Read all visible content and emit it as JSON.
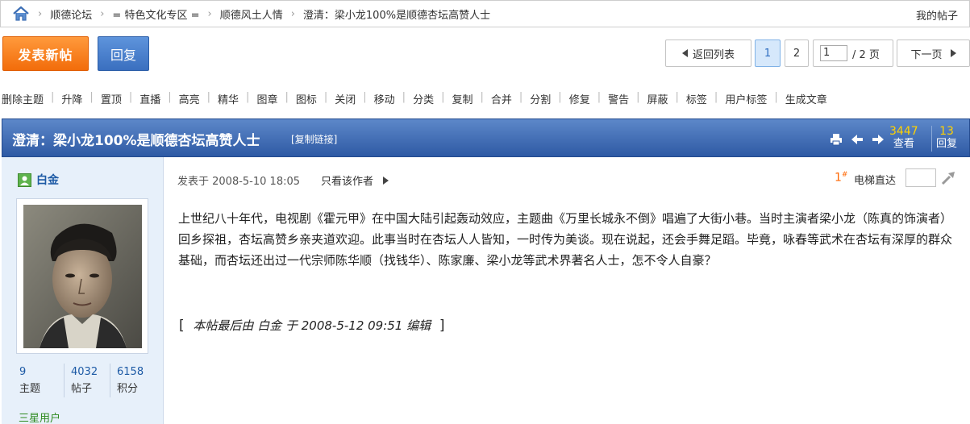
{
  "breadcrumb": {
    "items": [
      "顺德论坛",
      "= 特色文化专区 =",
      "顺德风土人情",
      "澄清：梁小龙100%是顺德杏坛高赞人士"
    ],
    "separator": "›",
    "my_posts": "我的帖子"
  },
  "actions": {
    "new_post": "发表新帖",
    "reply": "回复"
  },
  "pager": {
    "back": "返回列表",
    "pages": [
      "1",
      "2"
    ],
    "current_page": "1",
    "input_value": "1",
    "total": "/ 2 页",
    "next": "下一页"
  },
  "mod_tools": [
    "删除主题",
    "升降",
    "置顶",
    "直播",
    "高亮",
    "精华",
    "图章",
    "图标",
    "关闭",
    "移动",
    "分类",
    "复制",
    "合并",
    "分割",
    "修复",
    "警告",
    "屏蔽",
    "标签",
    "用户标签",
    "生成文章"
  ],
  "thread": {
    "title": "澄清：梁小龙100%是顺德杏坛高赞人士",
    "copy_link": "[复制链接]",
    "views": "3447",
    "views_label": "查看",
    "replies": "13",
    "replies_label": "回复"
  },
  "author": {
    "name": "白金",
    "stats": [
      {
        "value": "9",
        "label": "主题"
      },
      {
        "value": "4032",
        "label": "帖子"
      },
      {
        "value": "6158",
        "label": "积分"
      }
    ],
    "rank": "三星用户"
  },
  "post": {
    "posted_at": "发表于 2008-5-10 18:05",
    "only_author": "只看该作者",
    "floor": "1",
    "floor_mark": "#",
    "jump_label": "电梯直达",
    "body": "上世纪八十年代，电视剧《霍元甲》在中国大陆引起轰动效应，主题曲《万里长城永不倒》唱遍了大街小巷。当时主演者梁小龙（陈真的饰演者）回乡探祖，杏坛高赞乡亲夹道欢迎。此事当时在杏坛人人皆知，一时传为美谈。现在说起，还会手舞足蹈。毕竟，咏春等武术在杏坛有深厚的群众基础，而杏坛还出过一代宗师陈华顺（找钱华）、陈家廉、梁小龙等武术界著名人士，怎不令人自豪？",
    "edit_note": "本帖最后由 白金 于 2008-5-12 09:51 编辑"
  },
  "icons": [
    "home-icon",
    "print-icon",
    "prev-thread-icon",
    "next-thread-icon",
    "user-icon",
    "jump-icon"
  ]
}
